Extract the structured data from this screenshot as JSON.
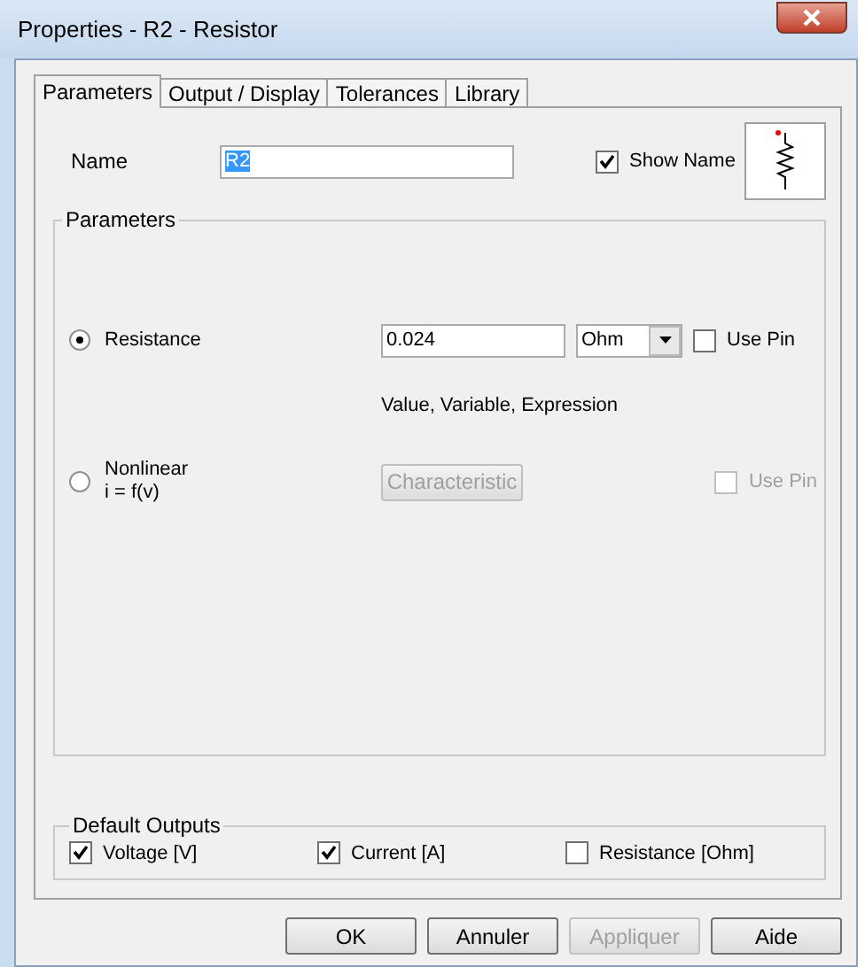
{
  "window": {
    "title": "Properties - R2 - Resistor"
  },
  "tabs": [
    {
      "label": "Parameters",
      "selected": true
    },
    {
      "label": "Output / Display",
      "selected": false
    },
    {
      "label": "Tolerances",
      "selected": false
    },
    {
      "label": "Library",
      "selected": false
    }
  ],
  "name": {
    "label": "Name",
    "value": "R2"
  },
  "show_name": {
    "label": "Show Name",
    "checked": true
  },
  "parameters": {
    "title": "Parameters",
    "options": [
      {
        "kind": "value",
        "label": "Resistance",
        "selected": true,
        "value": "0.024",
        "unit": "Ohm",
        "use_pin": {
          "label": "Use Pin",
          "checked": false,
          "disabled": false
        },
        "hint": "Value, Variable, Expression"
      },
      {
        "kind": "characteristic",
        "label": "Nonlinear",
        "sublabel": "i = f(v)",
        "selected": false,
        "button": {
          "label": "Characteristic",
          "disabled": true
        },
        "use_pin": {
          "label": "Use Pin",
          "checked": false,
          "disabled": true
        }
      }
    ]
  },
  "default_outputs": {
    "title": "Default Outputs",
    "items": [
      {
        "label": "Voltage [V]",
        "checked": true
      },
      {
        "label": "Current [A]",
        "checked": true
      },
      {
        "label": "Resistance [Ohm]",
        "checked": false
      }
    ]
  },
  "buttons": [
    {
      "label": "OK",
      "disabled": false
    },
    {
      "label": "Annuler",
      "disabled": false
    },
    {
      "label": "Appliquer",
      "disabled": true
    },
    {
      "label": "Aide",
      "disabled": false
    }
  ]
}
